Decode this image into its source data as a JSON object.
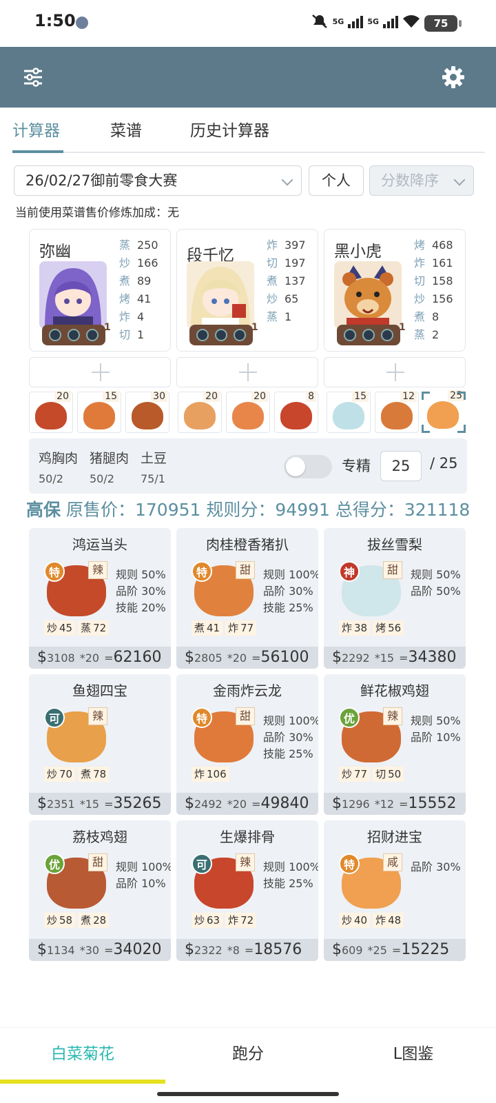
{
  "status": {
    "time": "1:50",
    "net1": "5G",
    "net2": "5G",
    "battery": "75"
  },
  "appbar": {
    "left_icon": "sliders-icon",
    "right_icon": "gear-icon"
  },
  "tabs": [
    {
      "label": "计算器"
    },
    {
      "label": "菜谱"
    },
    {
      "label": "历史计算器"
    }
  ],
  "contest_select": {
    "value": "26/02/27御前零食大赛"
  },
  "mode_button": {
    "label": "个人"
  },
  "sort_select": {
    "value": "分数降序"
  },
  "bonus_line": "当前使用菜谱售价修炼加成：无",
  "chefs": [
    {
      "name": "弥幽",
      "level": "1",
      "skills": [
        {
          "k": "蒸",
          "v": "250"
        },
        {
          "k": "炒",
          "v": "166"
        },
        {
          "k": "煮",
          "v": "89"
        },
        {
          "k": "烤",
          "v": "41"
        },
        {
          "k": "炸",
          "v": "4"
        },
        {
          "k": "切",
          "v": "1"
        }
      ]
    },
    {
      "name": "段千忆",
      "level": "1",
      "skills": [
        {
          "k": "炸",
          "v": "397"
        },
        {
          "k": "切",
          "v": "197"
        },
        {
          "k": "煮",
          "v": "137"
        },
        {
          "k": "炒",
          "v": "65"
        },
        {
          "k": "蒸",
          "v": "1"
        }
      ]
    },
    {
      "name": "黑小虎",
      "level": "1",
      "skills": [
        {
          "k": "烤",
          "v": "468"
        },
        {
          "k": "炸",
          "v": "161"
        },
        {
          "k": "切",
          "v": "158"
        },
        {
          "k": "炒",
          "v": "156"
        },
        {
          "k": "煮",
          "v": "8"
        },
        {
          "k": "蒸",
          "v": "2"
        }
      ]
    }
  ],
  "dish_counts": [
    "20",
    "15",
    "30",
    "20",
    "20",
    "8",
    "15",
    "12",
    "25"
  ],
  "ingredients": [
    {
      "name": "鸡胸肉",
      "value": "50/2"
    },
    {
      "name": "猪腿肉",
      "value": "50/2"
    },
    {
      "name": "土豆",
      "value": "75/1"
    }
  ],
  "special": {
    "label": "专精",
    "value": "25",
    "max": "/ 25"
  },
  "summary": {
    "grade": "高保",
    "base_label": "原售价：",
    "base": "170951",
    "rule_label": "规则分：",
    "rule": "94991",
    "total_label": "总得分：",
    "total": "321118"
  },
  "recipes": [
    {
      "name": "鸿运当头",
      "rarity": "特",
      "flavor": "辣",
      "bonuses": [
        "规则 50%",
        "品阶 30%",
        "技能 20%"
      ],
      "reqs": [
        {
          "k": "炒",
          "v": "45"
        },
        {
          "k": "蒸",
          "v": "72"
        }
      ],
      "price": "3108",
      "mult": "*20",
      "eq": "=",
      "total": "62160"
    },
    {
      "name": "肉桂橙香猪扒",
      "rarity": "特",
      "flavor": "甜",
      "bonuses": [
        "规则 100%",
        "品阶 30%",
        "技能 25%"
      ],
      "reqs": [
        {
          "k": "煮",
          "v": "41"
        },
        {
          "k": "炸",
          "v": "77"
        }
      ],
      "price": "2805",
      "mult": "*20",
      "eq": "=",
      "total": "56100"
    },
    {
      "name": "拔丝雪梨",
      "rarity": "神",
      "flavor": "甜",
      "bonuses": [
        "规则 50%",
        "品阶 50%"
      ],
      "reqs": [
        {
          "k": "炸",
          "v": "38"
        },
        {
          "k": "烤",
          "v": "56"
        }
      ],
      "price": "2292",
      "mult": "*15",
      "eq": "=",
      "total": "34380"
    },
    {
      "name": "鱼翅四宝",
      "rarity": "可",
      "flavor": "辣",
      "bonuses": [],
      "reqs": [
        {
          "k": "炒",
          "v": "70"
        },
        {
          "k": "煮",
          "v": "78"
        }
      ],
      "price": "2351",
      "mult": "*15",
      "eq": "=",
      "total": "35265"
    },
    {
      "name": "金雨炸云龙",
      "rarity": "特",
      "flavor": "甜",
      "bonuses": [
        "规则 100%",
        "品阶 30%",
        "技能 25%"
      ],
      "reqs": [
        {
          "k": "炸",
          "v": "106"
        }
      ],
      "price": "2492",
      "mult": "*20",
      "eq": "=",
      "total": "49840"
    },
    {
      "name": "鲜花椒鸡翅",
      "rarity": "优",
      "flavor": "辣",
      "bonuses": [
        "规则 50%",
        "品阶 10%"
      ],
      "reqs": [
        {
          "k": "炒",
          "v": "77"
        },
        {
          "k": "切",
          "v": "50"
        }
      ],
      "price": "1296",
      "mult": "*12",
      "eq": "=",
      "total": "15552"
    },
    {
      "name": "荔枝鸡翅",
      "rarity": "优",
      "flavor": "甜",
      "bonuses": [
        "规则 100%",
        "品阶 10%"
      ],
      "reqs": [
        {
          "k": "炒",
          "v": "58"
        },
        {
          "k": "煮",
          "v": "28"
        }
      ],
      "price": "1134",
      "mult": "*30",
      "eq": "=",
      "total": "34020"
    },
    {
      "name": "生爆排骨",
      "rarity": "可",
      "flavor": "辣",
      "bonuses": [
        "规则 100%",
        "技能 25%"
      ],
      "reqs": [
        {
          "k": "炒",
          "v": "63"
        },
        {
          "k": "炸",
          "v": "72"
        }
      ],
      "price": "2322",
      "mult": "*8",
      "eq": "=",
      "total": "18576"
    },
    {
      "name": "招财进宝",
      "rarity": "特",
      "flavor": "咸",
      "bonuses": [
        "品阶 30%"
      ],
      "reqs": [
        {
          "k": "炒",
          "v": "40"
        },
        {
          "k": "炸",
          "v": "48"
        }
      ],
      "price": "609",
      "mult": "*25",
      "eq": "=",
      "total": "15225"
    }
  ],
  "currency": "$",
  "nav": [
    {
      "label": "白菜菊花"
    },
    {
      "label": "跑分"
    },
    {
      "label": "L图鉴"
    }
  ],
  "colors": {
    "accent": "#5c8fa0",
    "appbar": "#5c7a8a",
    "nav_active": "#2ab8b0",
    "nav_underline": "#e6e01e",
    "rarity_te": "#e0892b",
    "rarity_shen": "#c0392b",
    "rarity_ke": "#3a6f73",
    "rarity_you": "#6aa33a"
  }
}
